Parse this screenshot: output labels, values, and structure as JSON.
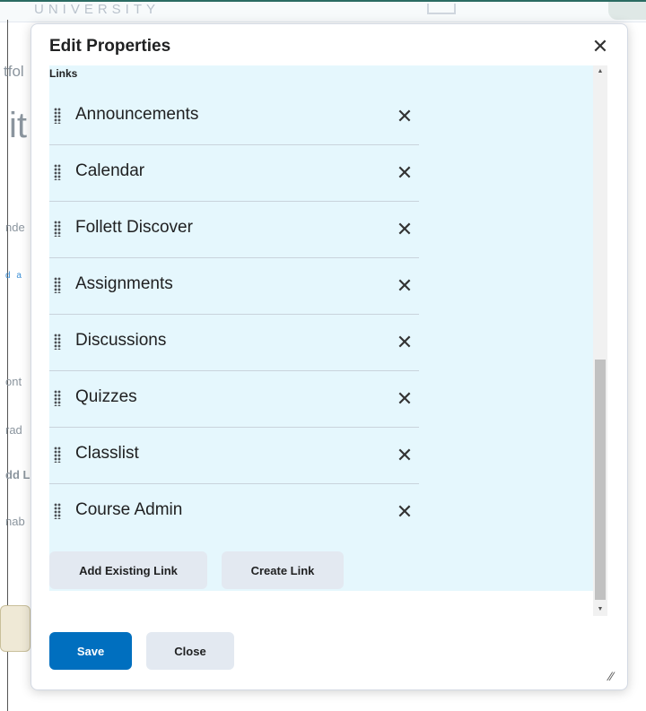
{
  "background": {
    "brand_text": "UNIVERSITY",
    "fragments": [
      "tfol",
      "it",
      "nde",
      "d a",
      "ont",
      "rad",
      "dd L",
      "nab"
    ]
  },
  "modal": {
    "title": "Edit Properties",
    "close_icon": "close-icon",
    "section_heading": "Links",
    "links": [
      {
        "label": "Announcements"
      },
      {
        "label": "Calendar"
      },
      {
        "label": "Follett Discover"
      },
      {
        "label": "Assignments"
      },
      {
        "label": "Discussions"
      },
      {
        "label": "Quizzes"
      },
      {
        "label": "Classlist"
      },
      {
        "label": "Course Admin"
      }
    ],
    "add_existing_label": "Add Existing Link",
    "create_link_label": "Create Link",
    "save_label": "Save",
    "close_label": "Close"
  },
  "colors": {
    "primary": "#006fbf",
    "list_background": "#e5f7fd",
    "secondary_button": "#e3e9f1"
  }
}
